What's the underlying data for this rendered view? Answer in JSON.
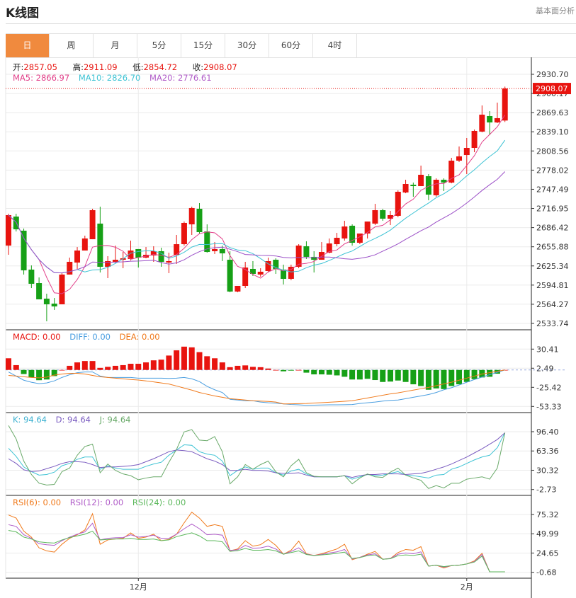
{
  "header": {
    "title": "K线图",
    "right_link": "基本面分析"
  },
  "tabs": [
    {
      "label": "日",
      "active": true
    },
    {
      "label": "周",
      "active": false
    },
    {
      "label": "月",
      "active": false
    },
    {
      "label": "5分",
      "active": false
    },
    {
      "label": "15分",
      "active": false
    },
    {
      "label": "30分",
      "active": false
    },
    {
      "label": "60分",
      "active": false
    },
    {
      "label": "4时",
      "active": false
    }
  ],
  "ohlc_legend": {
    "open_label": "开:",
    "open": "2857.05",
    "high_label": "高:",
    "high": "2911.09",
    "low_label": "低:",
    "low": "2854.72",
    "close_label": "收:",
    "close": "2908.07"
  },
  "ma_legend": {
    "ma5": "MA5: 2866.97",
    "ma10": "MA10: 2826.70",
    "ma20": "MA20: 2776.61"
  },
  "macd_legend": {
    "macd": "MACD: 0.00",
    "diff": "DIFF: 0.00",
    "dea": "DEA: 0.00"
  },
  "kdj_legend": {
    "k": "K: 94.64",
    "d": "D: 94.64",
    "j": "J: 94.64"
  },
  "rsi_legend": {
    "rsi6": "RSI(6): 0.00",
    "rsi12": "RSI(12): 0.00",
    "rsi24": "RSI(24): 0.00"
  },
  "colors": {
    "up": "#e8140f",
    "down": "#16a016",
    "ma5": "#e2418a",
    "ma10": "#3ec3d4",
    "ma20": "#9b4fc7",
    "diff": "#4a9ee0",
    "dea": "#f07a1c",
    "k": "#3ec3d4",
    "d": "#7a5cc0",
    "j": "#6aaa6a",
    "rsi6": "#f07a1c",
    "rsi12": "#b05cc8",
    "rsi24": "#5cb85c",
    "accent": "#f08a3e"
  },
  "chart_data": [
    {
      "type": "candlestick",
      "ylim": [
        2533.74,
        2930.7
      ],
      "y_ticks": [
        "2930.70",
        "2900.17",
        "2869.63",
        "2839.10",
        "2808.56",
        "2778.02",
        "2747.49",
        "2716.95",
        "2686.42",
        "2655.88",
        "2625.34",
        "2594.81",
        "2564.27",
        "2533.74"
      ],
      "last_price": "2908.07",
      "x_labels": [
        {
          "label": "12月",
          "index": 17
        },
        {
          "label": "2月",
          "index": 60
        }
      ],
      "moving_averages": [
        5,
        10,
        20
      ],
      "candles_ohlc": [
        [
          2657.8,
          2708.5,
          2643.1,
          2706.3
        ],
        [
          2704.0,
          2708.5,
          2680.3,
          2683.7
        ],
        [
          2681.5,
          2684.9,
          2611.6,
          2618.3
        ],
        [
          2619.5,
          2626.2,
          2590.1,
          2596.9
        ],
        [
          2598.0,
          2607.0,
          2572.1,
          2572.1
        ],
        [
          2573.2,
          2581.1,
          2537.1,
          2564.2
        ],
        [
          2565.3,
          2574.3,
          2555.2,
          2560.8
        ],
        [
          2564.2,
          2614.9,
          2564.2,
          2611.6
        ],
        [
          2611.6,
          2638.6,
          2611.6,
          2631.9
        ],
        [
          2630.7,
          2655.5,
          2620.6,
          2649.9
        ],
        [
          2649.9,
          2673.6,
          2649.9,
          2669.1
        ],
        [
          2667.9,
          2716.4,
          2667.9,
          2714.2
        ],
        [
          2692.8,
          2719.8,
          2614.9,
          2624.0
        ],
        [
          2624.0,
          2640.9,
          2605.9,
          2633.0
        ],
        [
          2631.9,
          2657.8,
          2629.6,
          2635.2
        ],
        [
          2635.2,
          2647.6,
          2621.7,
          2637.5
        ],
        [
          2636.4,
          2665.7,
          2634.1,
          2649.9
        ],
        [
          2652.2,
          2652.2,
          2622.8,
          2638.6
        ],
        [
          2638.6,
          2655.5,
          2637.5,
          2643.1
        ],
        [
          2642.0,
          2656.7,
          2631.9,
          2648.8
        ],
        [
          2648.8,
          2654.4,
          2624.0,
          2631.9
        ],
        [
          2630.7,
          2646.5,
          2613.8,
          2633.0
        ],
        [
          2643.1,
          2674.7,
          2628.5,
          2660.0
        ],
        [
          2660.0,
          2696.1,
          2657.8,
          2693.9
        ],
        [
          2691.6,
          2719.8,
          2674.7,
          2717.6
        ],
        [
          2716.4,
          2725.5,
          2677.0,
          2679.2
        ],
        [
          2680.3,
          2691.6,
          2646.5,
          2647.6
        ],
        [
          2648.8,
          2663.4,
          2644.3,
          2652.2
        ],
        [
          2652.2,
          2657.8,
          2633.0,
          2645.4
        ],
        [
          2635.2,
          2648.8,
          2583.4,
          2584.5
        ],
        [
          2584.5,
          2593.5,
          2583.4,
          2593.5
        ],
        [
          2593.5,
          2631.9,
          2590.1,
          2622.8
        ],
        [
          2620.6,
          2633.0,
          2609.3,
          2612.7
        ],
        [
          2611.6,
          2621.7,
          2608.2,
          2616.1
        ],
        [
          2617.2,
          2638.6,
          2614.9,
          2633.0
        ],
        [
          2635.2,
          2637.5,
          2612.7,
          2620.6
        ],
        [
          2619.5,
          2627.4,
          2595.8,
          2604.8
        ],
        [
          2604.8,
          2627.4,
          2602.5,
          2624.0
        ],
        [
          2624.0,
          2660.0,
          2621.7,
          2657.8
        ],
        [
          2656.7,
          2664.6,
          2636.4,
          2639.8
        ],
        [
          2639.8,
          2648.8,
          2614.9,
          2635.2
        ],
        [
          2635.2,
          2663.4,
          2635.2,
          2647.6
        ],
        [
          2646.5,
          2669.1,
          2645.4,
          2661.2
        ],
        [
          2660.0,
          2678.1,
          2656.7,
          2670.2
        ],
        [
          2669.1,
          2697.3,
          2665.7,
          2688.2
        ],
        [
          2689.4,
          2691.6,
          2657.8,
          2662.3
        ],
        [
          2662.3,
          2677.0,
          2660.0,
          2677.0
        ],
        [
          2677.0,
          2696.1,
          2669.1,
          2696.1
        ],
        [
          2692.8,
          2724.3,
          2690.5,
          2714.2
        ],
        [
          2714.2,
          2716.4,
          2697.3,
          2700.6
        ],
        [
          2700.6,
          2713.1,
          2690.5,
          2706.3
        ],
        [
          2705.2,
          2745.8,
          2702.9,
          2743.5
        ],
        [
          2742.4,
          2762.7,
          2741.2,
          2755.9
        ],
        [
          2754.8,
          2758.2,
          2735.6,
          2752.5
        ],
        [
          2752.5,
          2785.2,
          2752.5,
          2770.6
        ],
        [
          2768.3,
          2771.7,
          2730.0,
          2739.0
        ],
        [
          2737.9,
          2764.9,
          2735.6,
          2762.7
        ],
        [
          2762.7,
          2764.9,
          2744.6,
          2758.2
        ],
        [
          2758.2,
          2797.6,
          2757.0,
          2793.1
        ],
        [
          2793.1,
          2815.7,
          2790.9,
          2799.9
        ],
        [
          2802.1,
          2829.2,
          2771.7,
          2813.4
        ],
        [
          2813.4,
          2842.7,
          2806.6,
          2840.5
        ],
        [
          2839.4,
          2881.1,
          2838.2,
          2866.4
        ],
        [
          2864.2,
          2872.1,
          2833.7,
          2854.0
        ],
        [
          2854.0,
          2885.6,
          2852.9,
          2860.8
        ],
        [
          2857.05,
          2911.09,
          2854.72,
          2908.07
        ]
      ]
    },
    {
      "type": "macd",
      "ylim": [
        -53.33,
        30.41
      ],
      "y_ticks": [
        "30.41",
        "2.49",
        "-25.42",
        "-53.33"
      ],
      "histogram": [
        17,
        7,
        -6,
        -11,
        -15,
        -14,
        -9,
        0,
        6,
        11,
        13,
        13,
        3,
        4.5,
        6,
        7,
        9,
        9,
        11,
        14,
        15,
        21,
        28.6,
        34,
        33,
        26,
        20,
        17,
        11,
        4,
        6,
        6.6,
        4.5,
        4,
        2,
        0,
        -2,
        -1,
        0,
        -4,
        -6.5,
        -6.5,
        -7,
        -8,
        -10,
        -14,
        -14,
        -13,
        -14.8,
        -17.6,
        -17,
        -15.5,
        -17.6,
        -21,
        -23.5,
        -29,
        -27,
        -28,
        -23.5,
        -21,
        -17.6,
        -13.5,
        -11,
        -10,
        -5.5,
        0
      ],
      "diff": [
        -3,
        -9,
        -15,
        -18,
        -20,
        -19,
        -16,
        -11,
        -7,
        -4,
        -3,
        -3,
        -9,
        -11,
        -11,
        -11,
        -11,
        -12,
        -12,
        -12,
        -12,
        -12.5,
        -12,
        -11,
        -13,
        -17,
        -24,
        -29,
        -33,
        -43,
        -44,
        -45,
        -45,
        -47,
        -48,
        -48.5,
        -49.6,
        -50.5,
        -51,
        -51.7,
        -51.5,
        -51.2,
        -51,
        -51,
        -50.8,
        -50.6,
        -49,
        -48,
        -47,
        -45.5,
        -44.5,
        -44,
        -42,
        -40,
        -38,
        -36,
        -33,
        -29,
        -26,
        -22,
        -18,
        -14,
        -10.5,
        -7,
        -3.5,
        0
      ],
      "dea": [
        -8,
        -9,
        -10,
        -11,
        -11.6,
        -10.5,
        -7.5,
        -6,
        -5,
        -5,
        -6,
        -8,
        -10,
        -11,
        -12,
        -13,
        -14,
        -14.8,
        -16,
        -17.5,
        -19,
        -20.6,
        -23.5,
        -26.5,
        -29.5,
        -33,
        -35.5,
        -38,
        -40,
        -42,
        -43,
        -44,
        -45,
        -45.5,
        -46,
        -47,
        -49.6,
        -49.5,
        -49.3,
        -49,
        -48.4,
        -47.8,
        -47.2,
        -46.5,
        -45.8,
        -45,
        -43,
        -41,
        -39,
        -37,
        -35,
        -33.5,
        -31.5,
        -29.5,
        -27.5,
        -25.5,
        -23,
        -20.5,
        -18,
        -15,
        -12,
        -9,
        -6,
        -4,
        -2,
        0
      ]
    },
    {
      "type": "kdj",
      "ylim": [
        -2.73,
        96.4
      ],
      "y_ticks": [
        "96.40",
        "63.36",
        "30.32",
        "-2.73"
      ],
      "k": [
        68,
        54,
        36,
        28,
        22,
        23,
        27,
        38,
        42,
        49,
        53,
        53,
        32,
        38,
        34,
        32,
        32,
        32,
        37,
        41,
        44,
        56,
        65,
        74,
        73,
        62,
        58,
        56,
        46,
        21,
        30,
        36,
        32,
        34,
        34,
        26,
        22,
        29,
        32,
        24,
        19,
        19,
        19,
        19,
        21,
        15,
        19,
        23,
        21,
        22,
        25,
        28,
        22,
        21,
        19,
        17,
        22,
        23,
        32,
        36,
        42,
        48,
        53,
        56,
        69,
        94.64
      ],
      "d": [
        50,
        42,
        31,
        28,
        29,
        33,
        37,
        42,
        45,
        45,
        44,
        40,
        35,
        36,
        36,
        37,
        38,
        40,
        45,
        50,
        56,
        62,
        65,
        64,
        62,
        56,
        50,
        46,
        40,
        30,
        30,
        32,
        30,
        30,
        29,
        26,
        25,
        25,
        26,
        22,
        19,
        19,
        19,
        19,
        21,
        18,
        21,
        23,
        23,
        24,
        24,
        24,
        23,
        24,
        25,
        28,
        32,
        36,
        41,
        47,
        53,
        60,
        67,
        75,
        83,
        94.64
      ],
      "j": [
        107,
        84,
        46,
        23,
        8,
        5,
        6,
        28,
        34,
        56,
        71,
        75,
        26,
        41,
        30,
        24,
        21,
        14,
        17,
        19,
        19,
        44,
        66,
        96,
        100,
        82,
        81,
        88,
        62,
        7,
        19,
        40,
        32,
        40,
        46,
        27.6,
        19,
        38,
        49,
        26,
        20,
        19,
        19,
        19,
        21,
        7,
        17,
        24,
        19,
        18,
        27,
        34,
        22,
        17,
        13,
        -1,
        4,
        0,
        8,
        8,
        15,
        17,
        19,
        15,
        34,
        94.64
      ]
    },
    {
      "type": "rsi",
      "ylim": [
        -0.68,
        75.32
      ],
      "y_ticks": [
        "75.32",
        "49.99",
        "24.65",
        "-0.68"
      ],
      "rsi6": [
        74.7,
        70.6,
        53.4,
        45.6,
        31.5,
        27.5,
        25.9,
        36.2,
        44.0,
        48.7,
        55.0,
        76.3,
        36.2,
        41.9,
        43.1,
        44.0,
        51.2,
        44.0,
        45.6,
        49.4,
        40.9,
        42.5,
        49.4,
        64.4,
        78.4,
        70.6,
        59.7,
        61.9,
        59.7,
        27.5,
        30.0,
        40.9,
        33.7,
        35.6,
        42.5,
        34.7,
        23.1,
        28.4,
        40.3,
        23.7,
        21.5,
        23.7,
        26.8,
        30.0,
        36.2,
        15.9,
        19.0,
        23.1,
        26.8,
        16.5,
        17.5,
        25.3,
        29.3,
        28.4,
        33.1,
        7.4,
        8.7,
        5.0,
        8.1,
        8.7,
        10.3,
        14.3,
        24.3,
        0,
        0,
        0
      ],
      "rsi12": [
        61.9,
        59.7,
        48.7,
        44.0,
        36.9,
        35.6,
        34.7,
        40.9,
        45.6,
        49.4,
        52.5,
        63.8,
        41.9,
        44.0,
        44.7,
        45.0,
        48.7,
        45.6,
        46.5,
        48.1,
        44.0,
        44.0,
        49.4,
        56.6,
        62.8,
        56.6,
        48.7,
        49.4,
        48.1,
        28.1,
        28.9,
        34.7,
        30.9,
        31.5,
        33.7,
        30.0,
        23.1,
        26.8,
        31.5,
        23.1,
        21.5,
        22.8,
        24.7,
        26.2,
        29.3,
        16.8,
        19.0,
        22.2,
        23.7,
        16.5,
        17.5,
        23.1,
        24.7,
        23.7,
        26.2,
        7.4,
        8.7,
        6.2,
        8.1,
        8.7,
        10.3,
        13.4,
        22.8,
        0,
        0,
        0
      ],
      "rsi24": [
        54.4,
        52.5,
        45.6,
        43.1,
        39.4,
        38.4,
        37.8,
        41.9,
        45.0,
        47.2,
        49.4,
        53.4,
        41.9,
        42.5,
        43.1,
        43.1,
        44.0,
        42.5,
        42.5,
        43.1,
        40.9,
        41.9,
        46.2,
        48.7,
        51.2,
        47.2,
        40.9,
        40.9,
        39.4,
        26.8,
        27.8,
        30.6,
        28.4,
        28.4,
        29.3,
        27.5,
        23.1,
        25.3,
        27.5,
        22.8,
        21.2,
        22.2,
        23.1,
        24.3,
        25.9,
        17.5,
        18.7,
        21.2,
        22.2,
        16.5,
        17.2,
        21.2,
        22.2,
        21.5,
        23.1,
        7.4,
        8.7,
        6.8,
        8.1,
        8.7,
        10.3,
        12.8,
        20.6,
        0,
        0,
        0
      ]
    }
  ]
}
